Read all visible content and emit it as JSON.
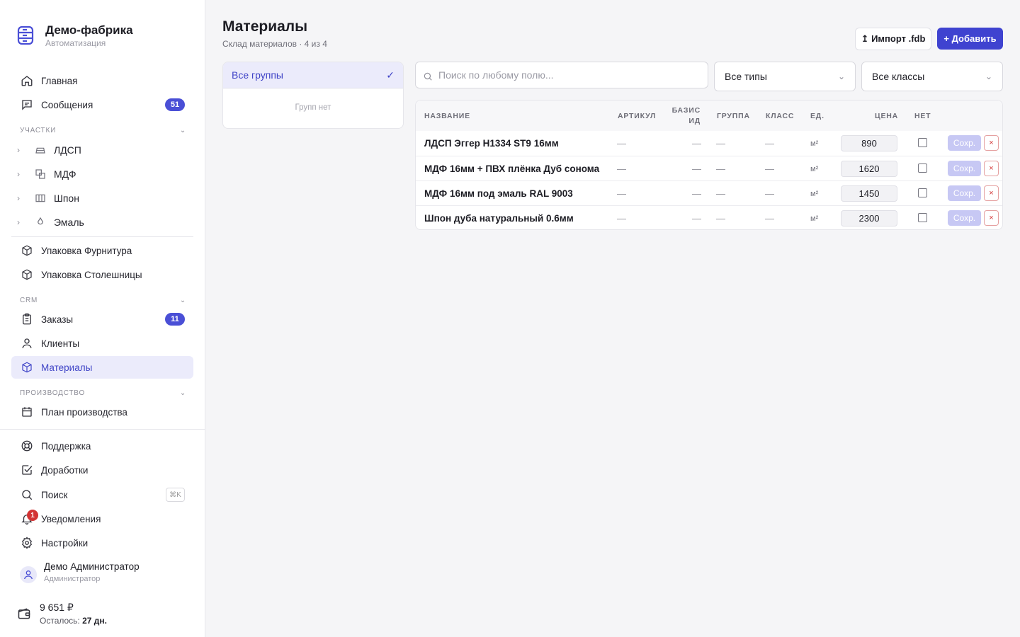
{
  "brand": {
    "name": "Демо-фабрика",
    "subtitle": "Автоматизация"
  },
  "nav": {
    "home": "Главная",
    "messages": "Сообщения",
    "messages_badge": "51",
    "section_areas": "Участки",
    "areas": [
      "ЛДСП",
      "МДФ",
      "Шпон",
      "Эмаль"
    ],
    "pack_fittings": "Упаковка Фурнитура",
    "pack_tops": "Упаковка Столешницы",
    "section_crm": "CRM",
    "orders": "Заказы",
    "orders_badge": "11",
    "clients": "Клиенты",
    "materials": "Материалы",
    "section_production": "Производство",
    "production_plan": "План производства",
    "support": "Поддержка",
    "improvements": "Доработки",
    "search": "Поиск",
    "search_shortcut": "⌘K",
    "notifications": "Уведомления",
    "notifications_badge": "1",
    "settings": "Настройки"
  },
  "user": {
    "name": "Демо Администратор",
    "role": "Администратор"
  },
  "wallet": {
    "amount": "9 651 ₽",
    "left_label": "Осталось:",
    "left_value": "27 дн."
  },
  "page": {
    "title": "Материалы",
    "subtitle": "Склад материалов · 4 из 4",
    "import_label": "↥ Импорт .fdb",
    "add_label": "+ Добавить"
  },
  "groups": {
    "all_label": "Все группы",
    "empty": "Групп нет"
  },
  "filters": {
    "search_placeholder": "Поиск по любому полю...",
    "types": "Все типы",
    "classes": "Все классы"
  },
  "table": {
    "headers": {
      "name": "Название",
      "sku": "Артикул",
      "basis_id": "Базис ИД",
      "group": "Группа",
      "class": "Класс",
      "unit": "Ед.",
      "price": "Цена",
      "none": "Нет"
    },
    "save_label": "Сохр.",
    "delete_label": "×",
    "dash": "—",
    "rows": [
      {
        "name": "ЛДСП Эггер H1334 ST9 16мм",
        "unit": "м²",
        "price": "890"
      },
      {
        "name": "МДФ 16мм + ПВХ плёнка Дуб сонома",
        "unit": "м²",
        "price": "1620"
      },
      {
        "name": "МДФ 16мм под эмаль RAL 9003",
        "unit": "м²",
        "price": "1450"
      },
      {
        "name": "Шпон дуба натуральный 0.6мм",
        "unit": "м²",
        "price": "2300"
      }
    ]
  },
  "colors": {
    "accent": "#3f43d0",
    "active_bg": "#ebebfb",
    "danger": "#d33434"
  }
}
